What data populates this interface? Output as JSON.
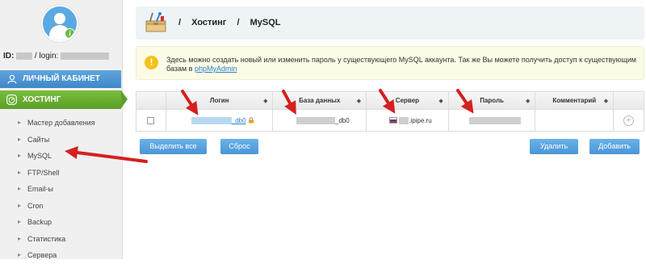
{
  "user": {
    "id_label": "ID:",
    "login_label": "/ login:"
  },
  "sidebar": {
    "cabinet_label": "ЛИЧНЫЙ КАБИНЕТ",
    "hosting_label": "ХОСТИНГ",
    "items": [
      {
        "label": "Мастер добавления"
      },
      {
        "label": "Сайты"
      },
      {
        "label": "MySQL"
      },
      {
        "label": "FTP/Shell"
      },
      {
        "label": "Email-ы"
      },
      {
        "label": "Cron"
      },
      {
        "label": "Backup"
      },
      {
        "label": "Статистика"
      },
      {
        "label": "Сервера"
      }
    ]
  },
  "breadcrumb": {
    "sep1": "/",
    "hosting": "Хостинг",
    "sep2": "/",
    "current": "MySQL"
  },
  "notice": {
    "text": "Здесь можно создать новый или изменить пароль у существующего MySQL аккаунта. Так же Вы можете получить доступ к существующим базам в",
    "link": "phpMyAdmin"
  },
  "table": {
    "headers": {
      "login": "Логин",
      "database": "База данных",
      "server": "Сервер",
      "password": "Пароль",
      "comment": "Комментарий"
    },
    "sort_glyph": "◆",
    "rows": [
      {
        "login_suffix": "_db0",
        "database_suffix": "_db0",
        "server_suffix": ".ipipe.ru"
      }
    ]
  },
  "buttons": {
    "select_all": "Выделить все",
    "reset": "Сброс",
    "delete": "Удалить",
    "add": "Добавить"
  },
  "colors": {
    "blue_nav": "#4a95d6",
    "green_nav": "#6ab945",
    "arrow": "#d42020"
  }
}
